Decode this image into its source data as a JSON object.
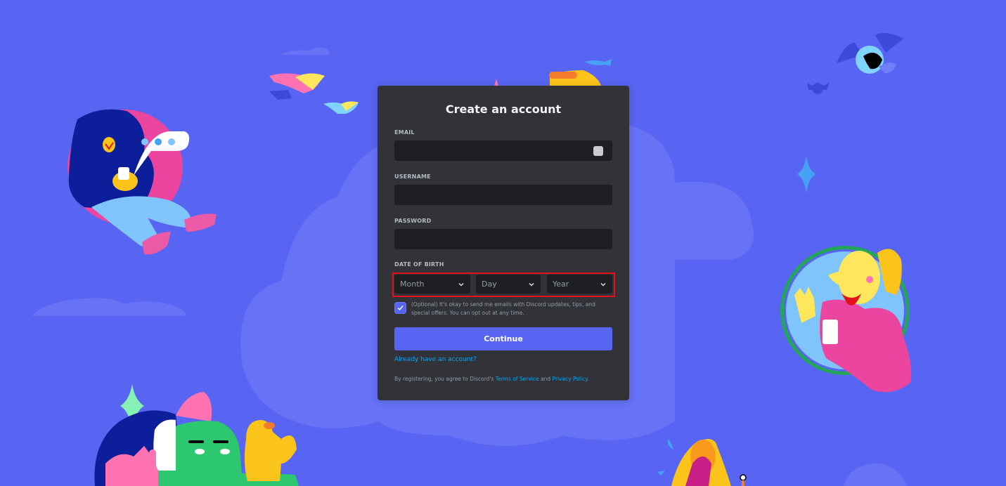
{
  "form": {
    "title": "Create an account",
    "fields": {
      "email": {
        "label": "EMAIL",
        "value": "",
        "placeholder": ""
      },
      "username": {
        "label": "USERNAME",
        "value": "",
        "placeholder": ""
      },
      "password": {
        "label": "PASSWORD",
        "value": "",
        "placeholder": ""
      }
    },
    "date_of_birth": {
      "label": "DATE OF BIRTH",
      "month": "Month",
      "day": "Day",
      "year": "Year"
    },
    "marketing_opt_in": {
      "checked": true,
      "text": "(Optional) It's okay to send me emails with Discord updates, tips, and special offers. You can opt out at any time."
    },
    "continue_label": "Continue",
    "login_link": "Already have an account?",
    "legal": {
      "prefix": "By registering, you agree to Discord's ",
      "terms": "Terms of Service",
      "and": " and ",
      "privacy": "Privacy Policy",
      "suffix": "."
    }
  },
  "icons": {
    "password_manager": "password-manager-icon",
    "chevron": "chevron-down-icon",
    "check": "checkmark-icon"
  },
  "colors": {
    "background": "#5865f2",
    "card": "#313338",
    "input": "#1e1f22",
    "accent": "#5865f2",
    "link": "#00a8fc",
    "highlight": "#e3111b"
  }
}
